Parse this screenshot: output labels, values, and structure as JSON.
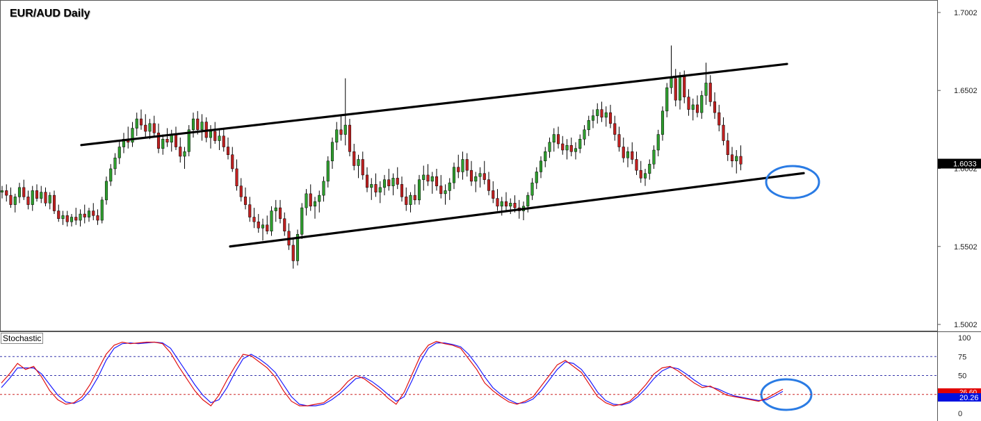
{
  "chart_data": {
    "type": "candlestick",
    "title": "EUR/AUD Daily",
    "price_axis": {
      "ticks": [
        "1.7002",
        "1.6502",
        "1.6002",
        "1.5502",
        "1.5002"
      ],
      "tick_values": [
        1.7002,
        1.6502,
        1.6002,
        1.5502,
        1.5002
      ],
      "range": [
        1.4962,
        1.7082
      ],
      "last_price": "1.6033",
      "last_price_value": 1.6033
    },
    "candles_ohlc": [
      [
        1.585,
        1.589,
        1.581,
        1.586
      ],
      [
        1.586,
        1.59,
        1.579,
        1.583
      ],
      [
        1.583,
        1.588,
        1.575,
        1.577
      ],
      [
        1.577,
        1.584,
        1.572,
        1.582
      ],
      [
        1.582,
        1.591,
        1.578,
        1.588
      ],
      [
        1.588,
        1.593,
        1.58,
        1.582
      ],
      [
        1.582,
        1.586,
        1.574,
        1.577
      ],
      [
        1.577,
        1.589,
        1.573,
        1.586
      ],
      [
        1.586,
        1.59,
        1.579,
        1.581
      ],
      [
        1.581,
        1.589,
        1.578,
        1.585
      ],
      [
        1.585,
        1.588,
        1.576,
        1.578
      ],
      [
        1.578,
        1.585,
        1.574,
        1.583
      ],
      [
        1.583,
        1.586,
        1.571,
        1.573
      ],
      [
        1.573,
        1.577,
        1.566,
        1.568
      ],
      [
        1.568,
        1.573,
        1.564,
        1.57
      ],
      [
        1.57,
        1.573,
        1.563,
        1.566
      ],
      [
        1.566,
        1.571,
        1.563,
        1.569
      ],
      [
        1.569,
        1.575,
        1.564,
        1.567
      ],
      [
        1.567,
        1.574,
        1.563,
        1.571
      ],
      [
        1.571,
        1.577,
        1.565,
        1.569
      ],
      [
        1.569,
        1.575,
        1.566,
        1.573
      ],
      [
        1.573,
        1.578,
        1.567,
        1.57
      ],
      [
        1.57,
        1.574,
        1.564,
        1.567
      ],
      [
        1.567,
        1.582,
        1.565,
        1.58
      ],
      [
        1.58,
        1.595,
        1.577,
        1.592
      ],
      [
        1.592,
        1.603,
        1.589,
        1.6
      ],
      [
        1.6,
        1.61,
        1.596,
        1.607
      ],
      [
        1.607,
        1.618,
        1.603,
        1.614
      ],
      [
        1.614,
        1.623,
        1.61,
        1.619
      ],
      [
        1.619,
        1.627,
        1.613,
        1.617
      ],
      [
        1.617,
        1.63,
        1.614,
        1.626
      ],
      [
        1.626,
        1.636,
        1.621,
        1.632
      ],
      [
        1.632,
        1.638,
        1.625,
        1.628
      ],
      [
        1.628,
        1.635,
        1.62,
        1.624
      ],
      [
        1.624,
        1.632,
        1.619,
        1.629
      ],
      [
        1.629,
        1.634,
        1.621,
        1.623
      ],
      [
        1.623,
        1.629,
        1.61,
        1.613
      ],
      [
        1.613,
        1.622,
        1.609,
        1.619
      ],
      [
        1.619,
        1.626,
        1.614,
        1.617
      ],
      [
        1.617,
        1.625,
        1.611,
        1.622
      ],
      [
        1.622,
        1.627,
        1.612,
        1.614
      ],
      [
        1.614,
        1.62,
        1.604,
        1.608
      ],
      [
        1.608,
        1.614,
        1.6,
        1.611
      ],
      [
        1.611,
        1.628,
        1.608,
        1.625
      ],
      [
        1.625,
        1.636,
        1.62,
        1.632
      ],
      [
        1.632,
        1.637,
        1.622,
        1.625
      ],
      [
        1.625,
        1.635,
        1.618,
        1.63
      ],
      [
        1.63,
        1.633,
        1.617,
        1.62
      ],
      [
        1.62,
        1.628,
        1.613,
        1.624
      ],
      [
        1.624,
        1.63,
        1.616,
        1.618
      ],
      [
        1.618,
        1.625,
        1.612,
        1.621
      ],
      [
        1.621,
        1.626,
        1.611,
        1.614
      ],
      [
        1.614,
        1.62,
        1.606,
        1.609
      ],
      [
        1.609,
        1.614,
        1.598,
        1.6
      ],
      [
        1.6,
        1.606,
        1.586,
        1.589
      ],
      [
        1.589,
        1.594,
        1.579,
        1.582
      ],
      [
        1.582,
        1.588,
        1.574,
        1.577
      ],
      [
        1.577,
        1.582,
        1.566,
        1.569
      ],
      [
        1.569,
        1.575,
        1.562,
        1.566
      ],
      [
        1.566,
        1.571,
        1.559,
        1.562
      ],
      [
        1.562,
        1.568,
        1.554,
        1.564
      ],
      [
        1.564,
        1.57,
        1.558,
        1.56
      ],
      [
        1.56,
        1.576,
        1.557,
        1.573
      ],
      [
        1.573,
        1.58,
        1.566,
        1.575
      ],
      [
        1.575,
        1.58,
        1.565,
        1.568
      ],
      [
        1.568,
        1.572,
        1.557,
        1.56
      ],
      [
        1.56,
        1.565,
        1.548,
        1.551
      ],
      [
        1.551,
        1.556,
        1.536,
        1.541
      ],
      [
        1.541,
        1.561,
        1.538,
        1.558
      ],
      [
        1.558,
        1.578,
        1.555,
        1.575
      ],
      [
        1.575,
        1.587,
        1.57,
        1.584
      ],
      [
        1.584,
        1.59,
        1.573,
        1.576
      ],
      [
        1.576,
        1.582,
        1.568,
        1.579
      ],
      [
        1.579,
        1.586,
        1.572,
        1.583
      ],
      [
        1.583,
        1.595,
        1.579,
        1.592
      ],
      [
        1.592,
        1.608,
        1.588,
        1.605
      ],
      [
        1.605,
        1.62,
        1.6,
        1.617
      ],
      [
        1.617,
        1.63,
        1.612,
        1.625
      ],
      [
        1.625,
        1.634,
        1.618,
        1.622
      ],
      [
        1.622,
        1.658,
        1.615,
        1.628
      ],
      [
        1.628,
        1.632,
        1.608,
        1.611
      ],
      [
        1.611,
        1.616,
        1.599,
        1.602
      ],
      [
        1.602,
        1.609,
        1.594,
        1.606
      ],
      [
        1.606,
        1.611,
        1.593,
        1.596
      ],
      [
        1.596,
        1.601,
        1.585,
        1.588
      ],
      [
        1.588,
        1.594,
        1.58,
        1.59
      ],
      [
        1.59,
        1.597,
        1.582,
        1.585
      ],
      [
        1.585,
        1.592,
        1.578,
        1.588
      ],
      [
        1.588,
        1.596,
        1.583,
        1.593
      ],
      [
        1.593,
        1.6,
        1.586,
        1.589
      ],
      [
        1.589,
        1.597,
        1.583,
        1.594
      ],
      [
        1.594,
        1.601,
        1.587,
        1.59
      ],
      [
        1.59,
        1.595,
        1.579,
        1.582
      ],
      [
        1.582,
        1.588,
        1.573,
        1.577
      ],
      [
        1.577,
        1.585,
        1.572,
        1.583
      ],
      [
        1.583,
        1.59,
        1.577,
        1.58
      ],
      [
        1.58,
        1.596,
        1.577,
        1.593
      ],
      [
        1.593,
        1.602,
        1.586,
        1.596
      ],
      [
        1.596,
        1.603,
        1.589,
        1.592
      ],
      [
        1.592,
        1.598,
        1.584,
        1.595
      ],
      [
        1.595,
        1.6,
        1.586,
        1.589
      ],
      [
        1.589,
        1.596,
        1.581,
        1.584
      ],
      [
        1.584,
        1.59,
        1.577,
        1.586
      ],
      [
        1.586,
        1.594,
        1.58,
        1.591
      ],
      [
        1.591,
        1.604,
        1.587,
        1.601
      ],
      [
        1.601,
        1.609,
        1.594,
        1.598
      ],
      [
        1.598,
        1.611,
        1.593,
        1.606
      ],
      [
        1.606,
        1.61,
        1.595,
        1.599
      ],
      [
        1.599,
        1.605,
        1.589,
        1.592
      ],
      [
        1.592,
        1.598,
        1.585,
        1.595
      ],
      [
        1.595,
        1.601,
        1.588,
        1.597
      ],
      [
        1.597,
        1.605,
        1.59,
        1.593
      ],
      [
        1.593,
        1.598,
        1.583,
        1.586
      ],
      [
        1.586,
        1.592,
        1.578,
        1.581
      ],
      [
        1.581,
        1.587,
        1.573,
        1.576
      ],
      [
        1.576,
        1.582,
        1.57,
        1.579
      ],
      [
        1.579,
        1.585,
        1.573,
        1.576
      ],
      [
        1.576,
        1.581,
        1.571,
        1.578
      ],
      [
        1.578,
        1.583,
        1.572,
        1.575
      ],
      [
        1.575,
        1.58,
        1.568,
        1.573
      ],
      [
        1.573,
        1.579,
        1.567,
        1.576
      ],
      [
        1.576,
        1.585,
        1.572,
        1.583
      ],
      [
        1.583,
        1.594,
        1.58,
        1.591
      ],
      [
        1.591,
        1.601,
        1.587,
        1.598
      ],
      [
        1.598,
        1.608,
        1.594,
        1.605
      ],
      [
        1.605,
        1.614,
        1.601,
        1.611
      ],
      [
        1.611,
        1.62,
        1.607,
        1.617
      ],
      [
        1.617,
        1.626,
        1.611,
        1.622
      ],
      [
        1.622,
        1.627,
        1.613,
        1.616
      ],
      [
        1.616,
        1.621,
        1.609,
        1.612
      ],
      [
        1.612,
        1.619,
        1.606,
        1.615
      ],
      [
        1.615,
        1.62,
        1.608,
        1.611
      ],
      [
        1.611,
        1.617,
        1.606,
        1.613
      ],
      [
        1.613,
        1.622,
        1.61,
        1.619
      ],
      [
        1.619,
        1.628,
        1.615,
        1.625
      ],
      [
        1.625,
        1.634,
        1.621,
        1.631
      ],
      [
        1.631,
        1.638,
        1.626,
        1.634
      ],
      [
        1.634,
        1.642,
        1.629,
        1.638
      ],
      [
        1.638,
        1.643,
        1.63,
        1.633
      ],
      [
        1.633,
        1.64,
        1.627,
        1.636
      ],
      [
        1.636,
        1.641,
        1.626,
        1.629
      ],
      [
        1.629,
        1.634,
        1.618,
        1.622
      ],
      [
        1.622,
        1.627,
        1.611,
        1.614
      ],
      [
        1.614,
        1.62,
        1.604,
        1.607
      ],
      [
        1.607,
        1.614,
        1.601,
        1.611
      ],
      [
        1.611,
        1.617,
        1.603,
        1.606
      ],
      [
        1.606,
        1.611,
        1.596,
        1.599
      ],
      [
        1.599,
        1.605,
        1.591,
        1.594
      ],
      [
        1.594,
        1.6,
        1.589,
        1.597
      ],
      [
        1.597,
        1.606,
        1.593,
        1.603
      ],
      [
        1.603,
        1.615,
        1.6,
        1.612
      ],
      [
        1.612,
        1.625,
        1.608,
        1.622
      ],
      [
        1.622,
        1.64,
        1.618,
        1.637
      ],
      [
        1.637,
        1.655,
        1.633,
        1.652
      ],
      [
        1.652,
        1.679,
        1.648,
        1.658
      ],
      [
        1.658,
        1.664,
        1.64,
        1.644
      ],
      [
        1.644,
        1.662,
        1.638,
        1.659
      ],
      [
        1.659,
        1.663,
        1.642,
        1.646
      ],
      [
        1.646,
        1.651,
        1.634,
        1.638
      ],
      [
        1.638,
        1.645,
        1.631,
        1.641
      ],
      [
        1.641,
        1.647,
        1.633,
        1.636
      ],
      [
        1.636,
        1.65,
        1.632,
        1.647
      ],
      [
        1.647,
        1.668,
        1.641,
        1.655
      ],
      [
        1.655,
        1.66,
        1.64,
        1.643
      ],
      [
        1.643,
        1.649,
        1.632,
        1.636
      ],
      [
        1.636,
        1.641,
        1.624,
        1.628
      ],
      [
        1.628,
        1.633,
        1.615,
        1.618
      ],
      [
        1.618,
        1.623,
        1.605,
        1.609
      ],
      [
        1.609,
        1.614,
        1.601,
        1.605
      ],
      [
        1.605,
        1.612,
        1.597,
        1.608
      ],
      [
        1.608,
        1.615,
        1.599,
        1.603
      ]
    ],
    "trendlines": [
      {
        "from": [
          0,
          1.6152
        ],
        "to": [
          180,
          1.6672
        ]
      },
      {
        "from": [
          36,
          1.5502
        ],
        "to": [
          180,
          1.5972
        ]
      }
    ],
    "highlight_circles": [
      "price-near-channel-support",
      "stochastic-oversold"
    ],
    "indicator": {
      "name": "Stochastic",
      "ticks": [
        "100",
        "75",
        "50",
        "25",
        "0"
      ],
      "tick_values": [
        100,
        75,
        50,
        25,
        0
      ],
      "levels": [
        75,
        50,
        25
      ],
      "readouts": [
        "26.60",
        "20.26"
      ],
      "k_values": [
        40,
        52,
        66,
        58,
        62,
        48,
        30,
        18,
        12,
        14,
        22,
        38,
        58,
        78,
        90,
        94,
        92,
        93,
        94,
        94,
        92,
        80,
        62,
        46,
        30,
        18,
        10,
        24,
        44,
        62,
        78,
        76,
        68,
        60,
        48,
        30,
        16,
        10,
        10,
        12,
        14,
        22,
        30,
        42,
        50,
        46,
        38,
        30,
        20,
        12,
        28,
        52,
        76,
        90,
        95,
        92,
        90,
        86,
        72,
        58,
        40,
        30,
        22,
        15,
        12,
        16,
        22,
        36,
        50,
        64,
        70,
        62,
        54,
        38,
        22,
        14,
        10,
        12,
        16,
        26,
        38,
        52,
        60,
        62,
        56,
        48,
        40,
        34,
        36,
        30,
        24,
        22,
        20,
        18,
        16,
        20,
        26,
        32
      ],
      "d_values": [
        34,
        46,
        60,
        60,
        60,
        52,
        38,
        24,
        15,
        13,
        18,
        30,
        48,
        70,
        86,
        92,
        93,
        92,
        93,
        94,
        93,
        86,
        70,
        54,
        38,
        24,
        14,
        18,
        34,
        54,
        72,
        78,
        72,
        64,
        54,
        38,
        22,
        12,
        10,
        10,
        12,
        18,
        26,
        36,
        46,
        48,
        42,
        34,
        25,
        16,
        22,
        44,
        68,
        86,
        93,
        93,
        91,
        88,
        78,
        64,
        48,
        34,
        25,
        18,
        13,
        14,
        19,
        30,
        44,
        58,
        68,
        66,
        58,
        44,
        28,
        17,
        12,
        11,
        14,
        22,
        33,
        46,
        56,
        61,
        59,
        52,
        44,
        37,
        35,
        32,
        27,
        23,
        21,
        19,
        17,
        18,
        23,
        29
      ]
    }
  }
}
